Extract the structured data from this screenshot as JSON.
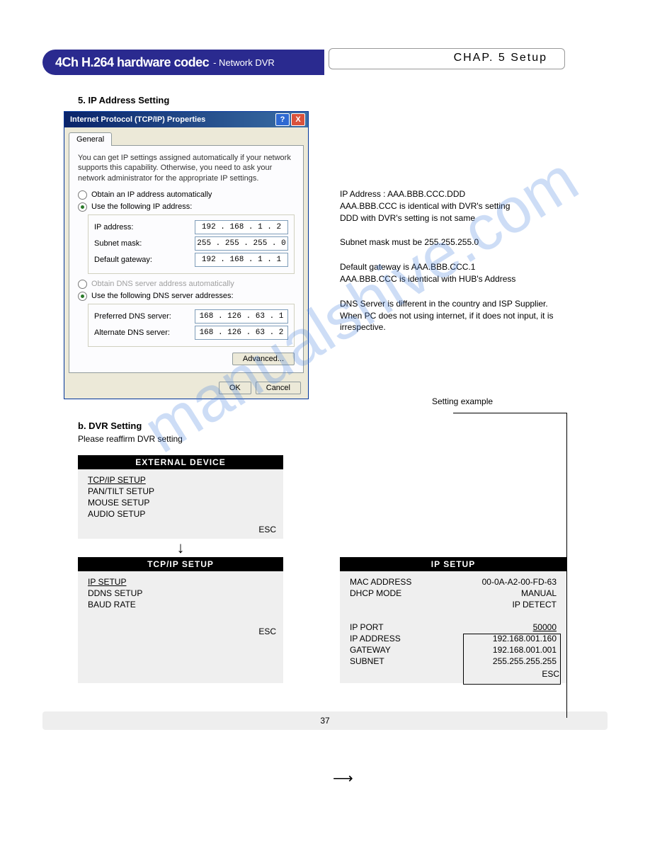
{
  "banner": {
    "title_bold": "4Ch H.264 hardware codec",
    "title_sub": "- Network DVR",
    "chapter": "CHAP. 5 Setup"
  },
  "section5_title": "5. IP Address Setting",
  "dialog": {
    "title": "Internet Protocol (TCP/IP) Properties",
    "tab_general": "General",
    "description": "You can get IP settings assigned automatically if your network supports this capability. Otherwise, you need to ask your network administrator for the appropriate IP settings.",
    "radio_obtain_ip": "Obtain an IP address automatically",
    "radio_use_ip": "Use the following IP address:",
    "label_ip": "IP address:",
    "label_subnet": "Subnet mask:",
    "label_gateway": "Default gateway:",
    "value_ip": "192 . 168 .  1  .  2",
    "value_subnet": "255 . 255 . 255 .  0",
    "value_gateway": "192 . 168 .  1  .  1",
    "radio_obtain_dns": "Obtain DNS server address automatically",
    "radio_use_dns": "Use the following DNS server addresses:",
    "label_pref_dns": "Preferred DNS server:",
    "label_alt_dns": "Alternate DNS server:",
    "value_pref_dns": "168 . 126 . 63 .  1",
    "value_alt_dns": "168 . 126 . 63 .  2",
    "btn_advanced": "Advanced...",
    "btn_ok": "OK",
    "btn_cancel": "Cancel"
  },
  "notes": {
    "ip1": "IP Address : AAA.BBB.CCC.DDD",
    "ip2": "AAA.BBB.CCC is identical with DVR's setting",
    "ip3": "DDD with DVR's setting is not same",
    "subnet": "Subnet mask must be 255.255.255.0",
    "gw1": "Default gateway is AAA.BBB.CCC.1",
    "gw2": "AAA.BBB.CCC is identical with HUB's Address",
    "dns1": "DNS Server is different in the country and ISP Supplier.",
    "dns2": "When PC does not using internet, if it does not input, it is irrespective.",
    "example_label": "Setting example"
  },
  "subsection_b": {
    "heading": "b. DVR Setting",
    "text": "Please reaffirm DVR setting"
  },
  "panel_external": {
    "title": "EXTERNAL DEVICE",
    "items": [
      "TCP/IP SETUP",
      "PAN/TILT SETUP",
      "MOUSE SETUP",
      "AUDIO SETUP"
    ],
    "esc": "ESC"
  },
  "panel_tcpip": {
    "title": "TCP/IP SETUP",
    "items": [
      "IP SETUP",
      "DDNS SETUP",
      "BAUD RATE"
    ],
    "esc": "ESC"
  },
  "panel_ip": {
    "title": "IP SETUP",
    "mac_label": "MAC ADDRESS",
    "mac_value": "00-0A-A2-00-FD-63",
    "dhcp_label": "DHCP MODE",
    "dhcp_value": "MANUAL",
    "ipdetect": "IP DETECT",
    "port_label": "IP PORT",
    "port_value": "50000",
    "addr_label": "IP ADDRESS",
    "addr_value": "192.168.001.160",
    "gw_label": "GATEWAY",
    "gw_value": "192.168.001.001",
    "sub_label": "SUBNET",
    "sub_value": "255.255.255.255",
    "esc": "ESC"
  },
  "watermark": "manualshive.com",
  "page_number": "37"
}
